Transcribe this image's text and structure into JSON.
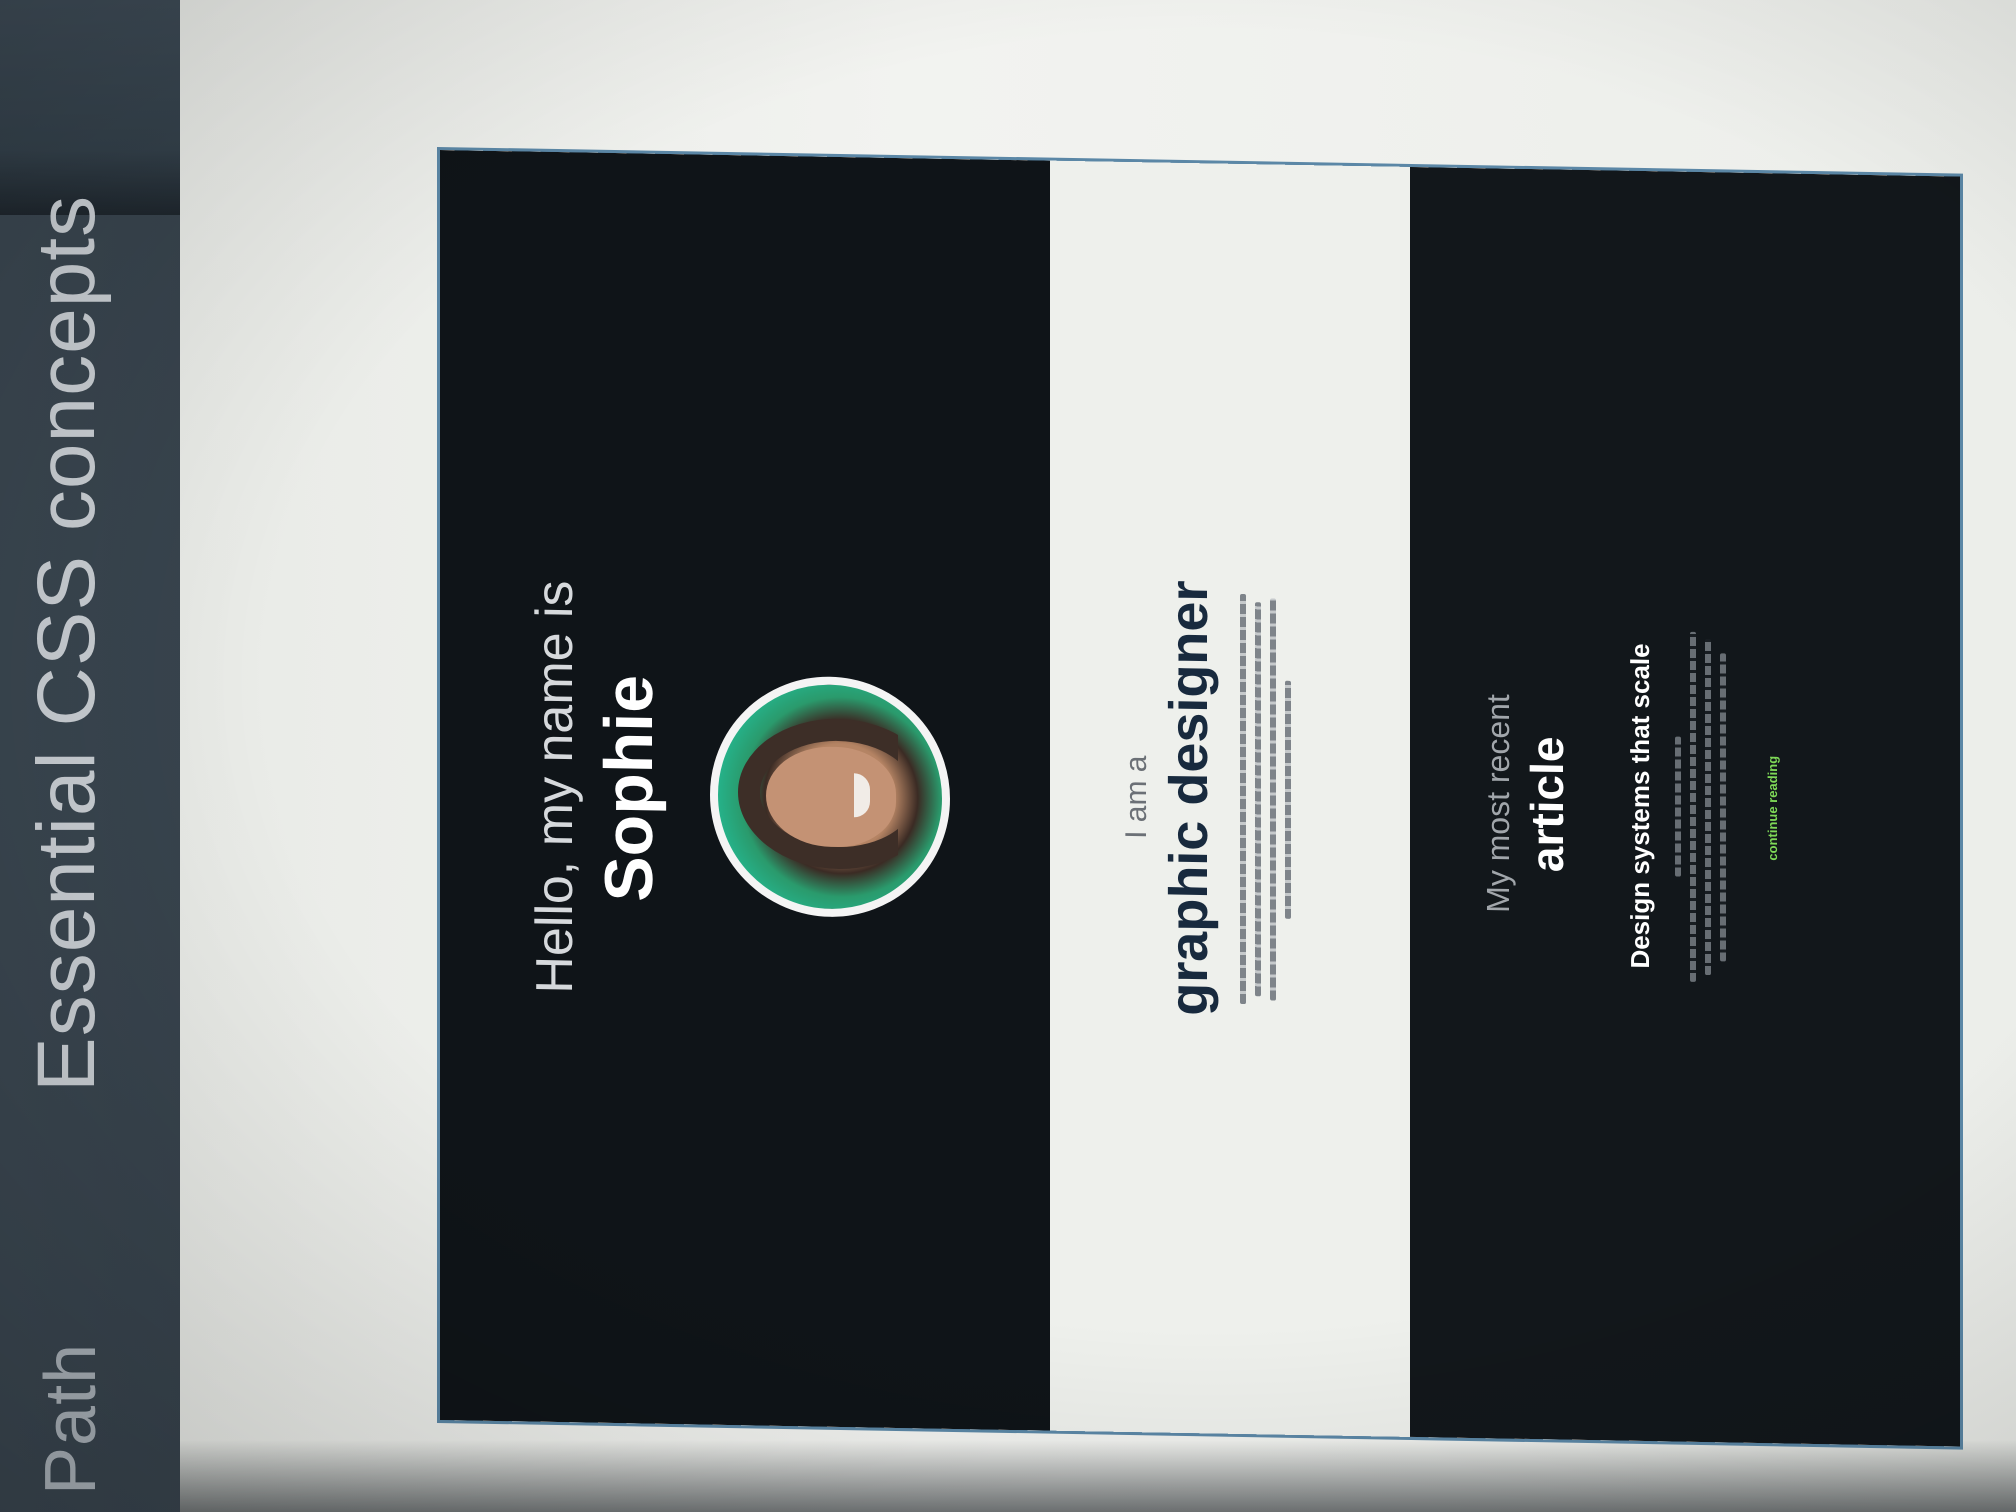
{
  "header": {
    "path_label": "er Path",
    "course_title": "Essential CSS concepts"
  },
  "hero": {
    "greeting": "Hello, my name is",
    "name": "Sophie",
    "avatar_icon": "portrait-photo"
  },
  "about": {
    "lead": "I am a",
    "role": "graphic designer"
  },
  "recent": {
    "lead": "My most recent",
    "heading": "article",
    "article_title": "Design systems that scale",
    "read_more": "continue reading"
  },
  "colors": {
    "hero_bg": "#0f1418",
    "about_bg": "#eef0ec",
    "recent_bg": "#12171b",
    "role_text": "#182a3e",
    "link_accent": "#7ed957",
    "header_bg": "#33404a"
  }
}
